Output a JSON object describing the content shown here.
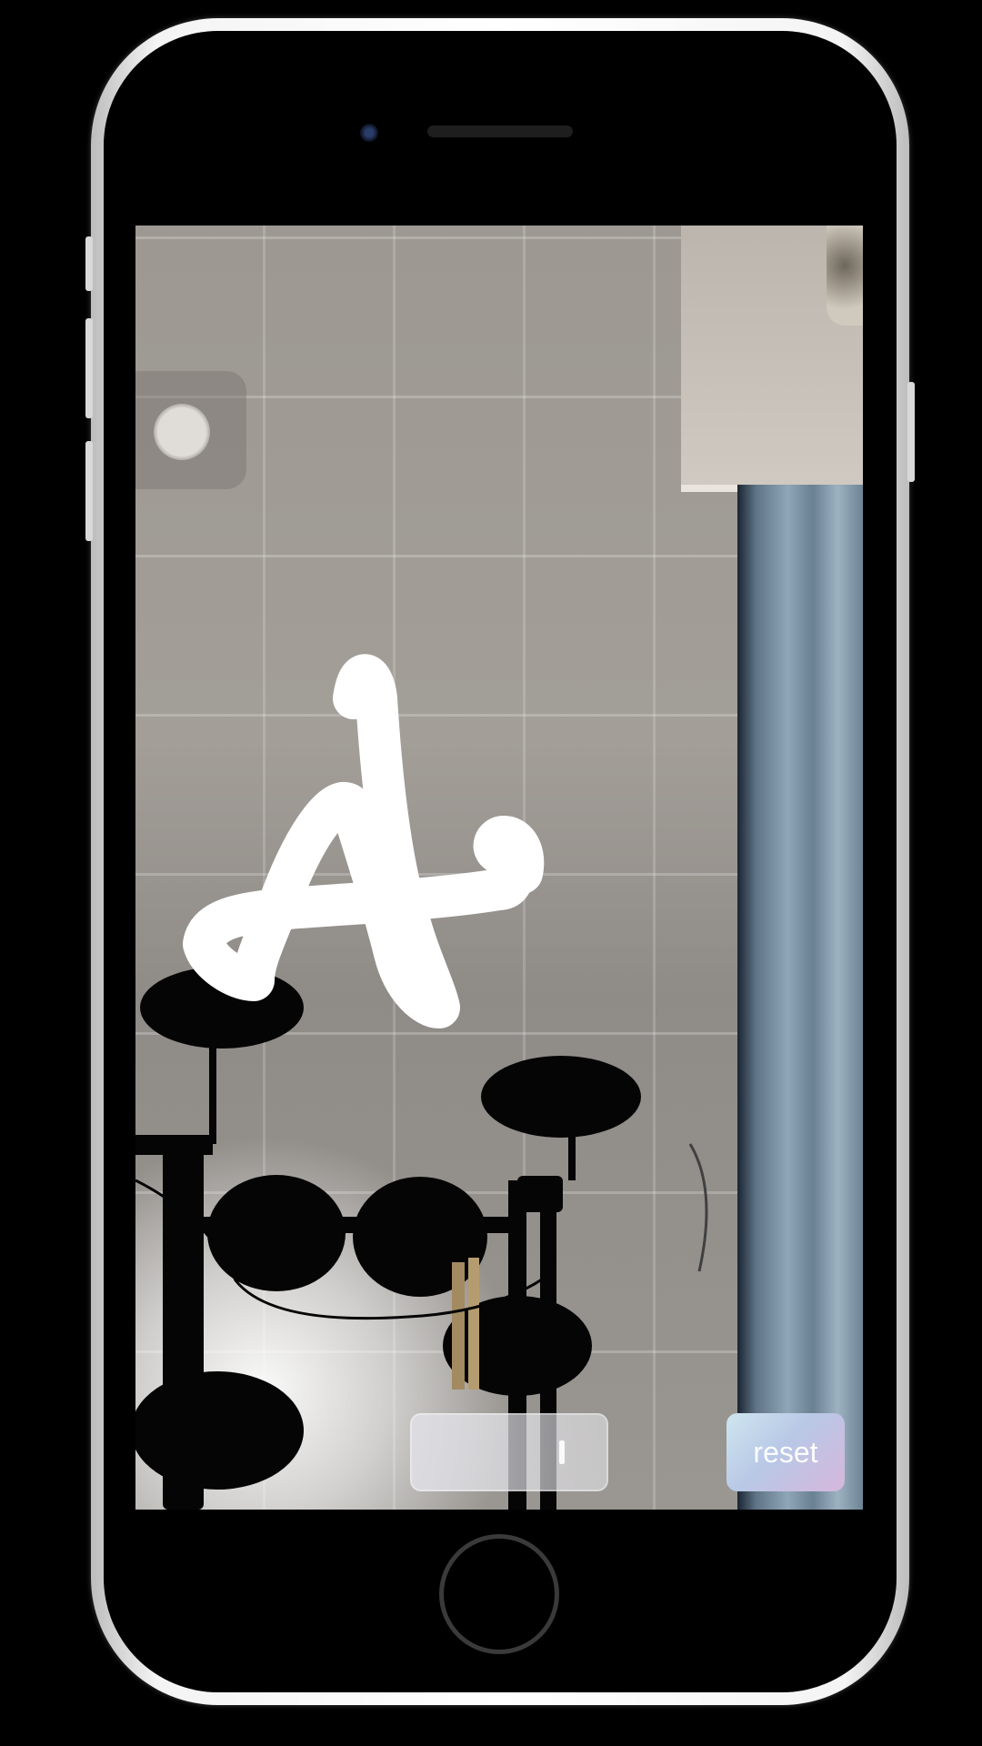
{
  "device": {
    "frame_color": "#ffffff"
  },
  "ar_view": {
    "drawing": {
      "color": "#ffffff"
    },
    "floating_button": {
      "icon": "assistive-touch-icon"
    }
  },
  "controls": {
    "slider": {
      "value": 0.8
    },
    "reset_label": "reset"
  }
}
